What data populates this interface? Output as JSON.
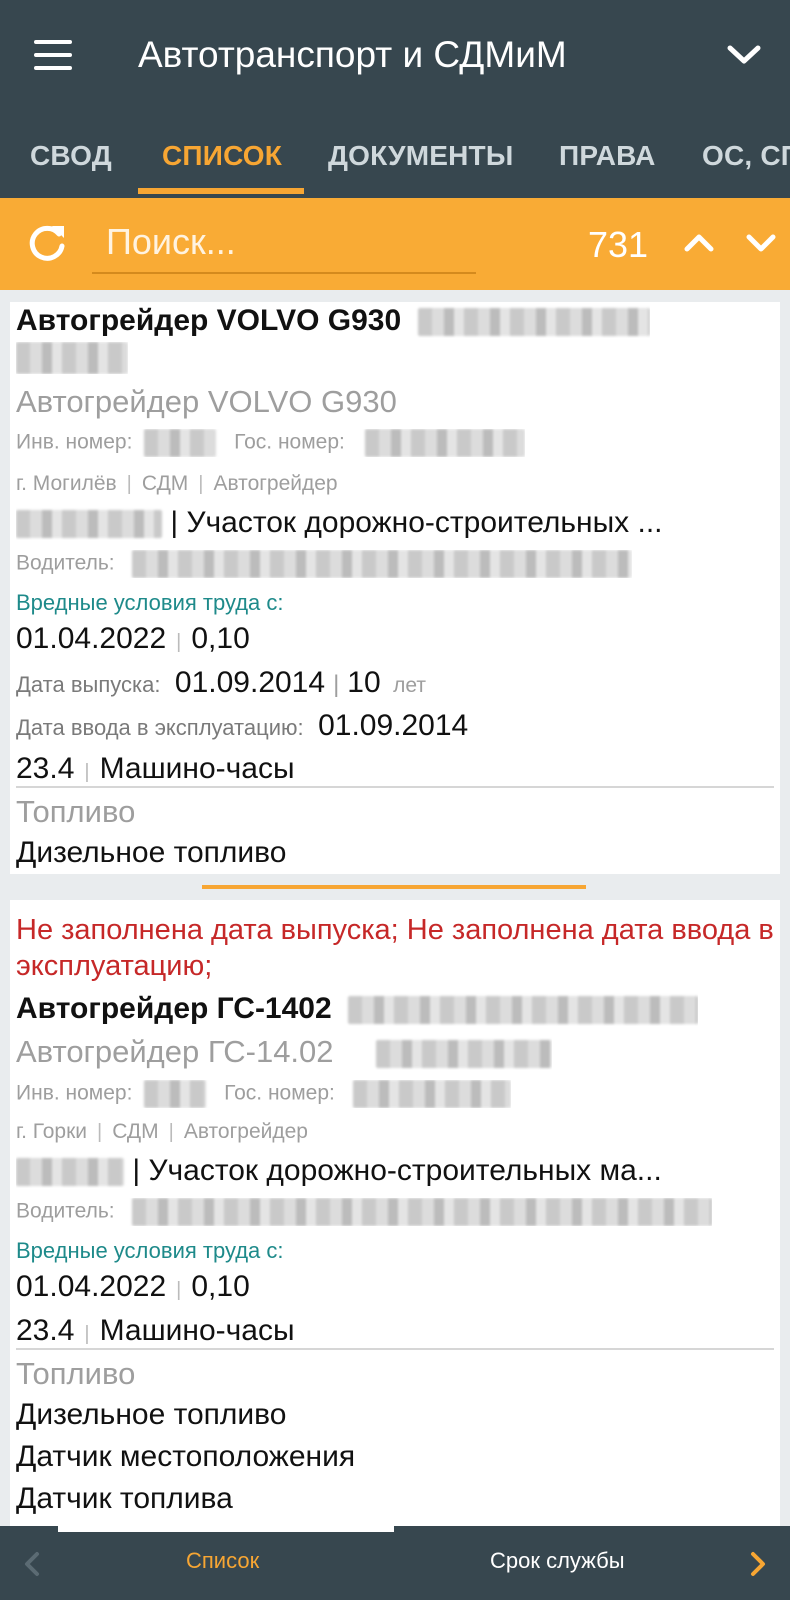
{
  "app": {
    "title": "Автотранспорт и СДМиМ"
  },
  "tabs": [
    {
      "label": "СВОД"
    },
    {
      "label": "СПИСОК"
    },
    {
      "label": "ДОКУМЕНТЫ"
    },
    {
      "label": "ПРАВА"
    },
    {
      "label": "ОС, СП"
    }
  ],
  "search": {
    "placeholder": "Поиск...",
    "count": "731"
  },
  "cards": [
    {
      "title": "Автогрейдер VOLVO G930",
      "model": "Автогрейдер VOLVO G930",
      "inv_label": "Инв. номер:",
      "gos_label": "Гос. номер:",
      "location": "г. Могилёв",
      "category": "СДМ",
      "type": "Автогрейдер",
      "department": "| Участок дорожно-строительных ...",
      "driver_label": "Водитель:",
      "harmful_label": "Вредные условия труда с:",
      "harmful_date": "01.04.2022",
      "harmful_coef": "0,10",
      "release_label": "Дата выпуска:",
      "release_date": "01.09.2014",
      "age_value": "10",
      "age_unit": "лет",
      "commission_label": "Дата ввода в эксплуатацию:",
      "commission_date": "01.09.2014",
      "meter_value": "23.4",
      "meter_unit": "Машино-часы",
      "fuel_label": "Топливо",
      "fuel_value": "Дизельное топливо"
    },
    {
      "warning": "Не заполнена дата выпуска; Не заполнена дата ввода в эксплуатацию;",
      "title": "Автогрейдер ГС-1402",
      "model": "Автогрейдер ГС-14.02",
      "inv_label": "Инв. номер:",
      "gos_label": "Гос. номер:",
      "location": "г. Горки",
      "category": "СДМ",
      "type": "Автогрейдер",
      "department": "| Участок дорожно-строительных ма...",
      "driver_label": "Водитель:",
      "harmful_label": "Вредные условия труда с:",
      "harmful_date": "01.04.2022",
      "harmful_coef": "0,10",
      "meter_value": "23.4",
      "meter_unit": "Машино-часы",
      "fuel_label": "Топливо",
      "fuel_value": "Дизельное топливо",
      "sensors": [
        "Датчик местоположения",
        "Датчик топлива"
      ]
    }
  ],
  "bottom_nav": {
    "current": "Список",
    "next": "Срок службы"
  },
  "colors": {
    "appbar": "#37474f",
    "accent": "#f9ab35",
    "warning": "#c62828",
    "teal": "#1e8a8a"
  },
  "icons": [
    "menu-icon",
    "chevron-down-icon",
    "refresh-icon",
    "chevron-up-icon",
    "chevron-left-icon",
    "chevron-right-icon"
  ]
}
